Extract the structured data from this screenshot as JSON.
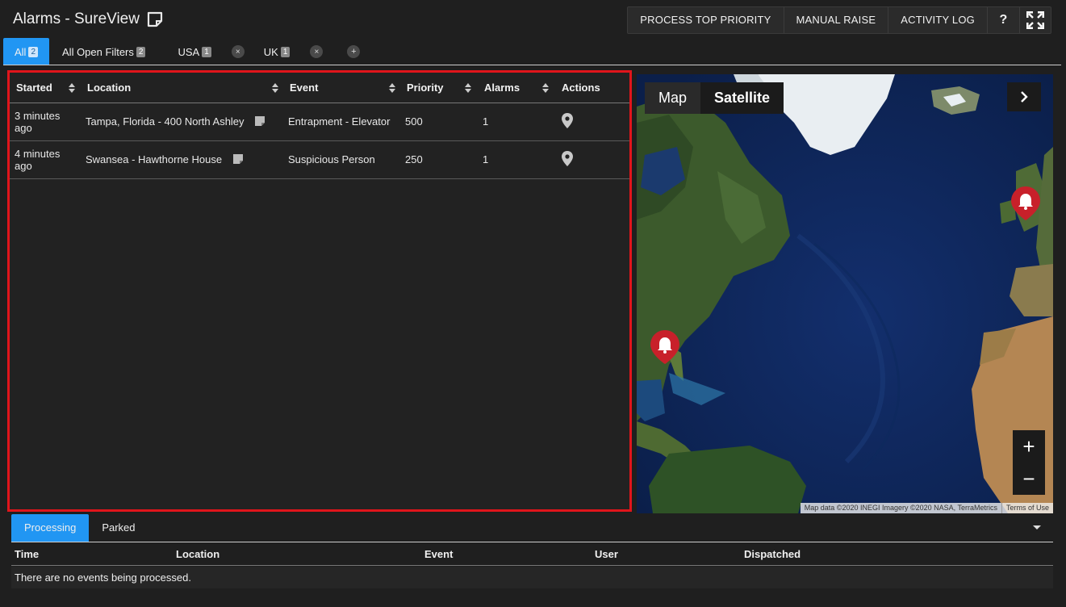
{
  "header": {
    "title": "Alarms - SureView",
    "buttons": {
      "process_top_priority": "PROCESS TOP PRIORITY",
      "manual_raise": "MANUAL RAISE",
      "activity_log": "ACTIVITY LOG",
      "help": "?"
    }
  },
  "filter_tabs": [
    {
      "label": "All",
      "count": "2",
      "active": true
    },
    {
      "label": "All Open Filters",
      "count": "2"
    },
    {
      "label": "USA",
      "count": "1",
      "close": "×"
    },
    {
      "label": "UK",
      "count": "1",
      "close": "×"
    },
    {
      "add": "+"
    }
  ],
  "alarm_table": {
    "columns": [
      "Started",
      "Location",
      "Event",
      "Priority",
      "Alarms",
      "Actions"
    ],
    "rows": [
      {
        "started": "3 minutes ago",
        "location": "Tampa, Florida - 400 North Ashley",
        "event": "Entrapment - Elevator",
        "priority": "500",
        "alarms": "1",
        "action_icon": "map-pin-icon"
      },
      {
        "started": "4 minutes ago",
        "location": "Swansea - Hawthorne House",
        "event": "Suspicious Person",
        "priority": "250",
        "alarms": "1",
        "action_icon": "map-pin-icon"
      }
    ]
  },
  "map": {
    "type_map": "Map",
    "type_satellite": "Satellite",
    "zoom_in": "+",
    "zoom_out": "−",
    "attribution": "Map data ©2020 INEGI Imagery ©2020 NASA, TerraMetrics",
    "terms": "Terms of Use",
    "marker_color": "#c8202a"
  },
  "bottom_tabs": [
    {
      "label": "Processing",
      "active": true
    },
    {
      "label": "Parked"
    }
  ],
  "processing_table": {
    "columns": [
      "Time",
      "Location",
      "Event",
      "User",
      "Dispatched"
    ],
    "empty_message": "There are no events being processed."
  },
  "colors": {
    "accent": "#2196f3",
    "highlight_border": "#e0151b",
    "background": "#1f1f1f"
  }
}
